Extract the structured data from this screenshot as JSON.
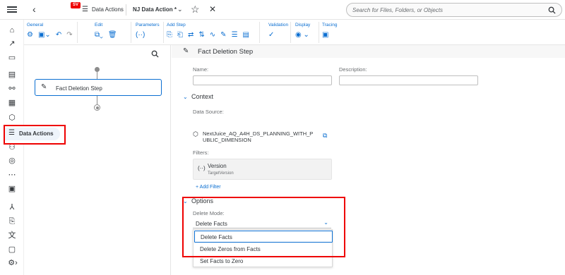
{
  "shell": {
    "app_title": "Data Actions",
    "logo_text": "SV",
    "doc_title": "NJ Data Action *",
    "search_placeholder": "Search for Files, Folders, or Objects"
  },
  "toolbar": {
    "groups": [
      {
        "label": "General"
      },
      {
        "label": "Edit"
      },
      {
        "label": "Parameters"
      },
      {
        "label": "Add Step"
      },
      {
        "label": "Validation"
      },
      {
        "label": "Display"
      },
      {
        "label": "Tracing"
      }
    ]
  },
  "nav_popup": {
    "label": "Data Actions"
  },
  "canvas": {
    "step_label": "Fact Deletion Step"
  },
  "panel": {
    "header_title": "Fact Deletion Step",
    "name_label": "Name:",
    "description_label": "Description:",
    "name_value": "",
    "description_value": "",
    "context_section": "Context",
    "data_source_label": "Data Source:",
    "data_source_value": "NextJuice_AQ_A4H_DS_PLANNING_WITH_PUBLIC_DIMENSION",
    "filters_label": "Filters:",
    "filter_name": "Version",
    "filter_value": "TargetVersion",
    "add_filter": "+ Add Filter",
    "options_section": "Options",
    "delete_mode_label": "Delete Mode:",
    "delete_mode_value": "Delete Facts",
    "delete_mode_options": [
      "Delete Facts",
      "Delete Zeros from Facts",
      "Set Facts to Zero"
    ]
  },
  "colors": {
    "accent": "#0a6ed1",
    "highlight": "#ee0000"
  }
}
